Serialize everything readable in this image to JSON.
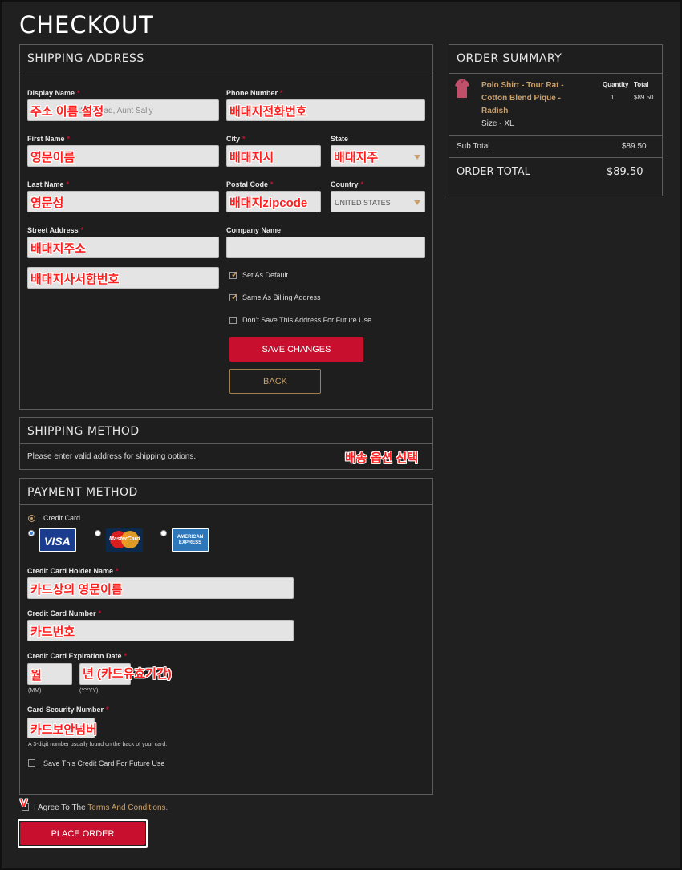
{
  "page": {
    "title": "CHECKOUT"
  },
  "shipping_address": {
    "heading": "SHIPPING ADDRESS",
    "display_name": {
      "label": "Display Name",
      "placeholder": "Grandma, Dad, Aunt Sally",
      "annotation": "주소 이름 설정"
    },
    "phone_number": {
      "label": "Phone Number",
      "annotation": "배대지전화번호"
    },
    "first_name": {
      "label": "First Name",
      "annotation": "영문이름"
    },
    "city": {
      "label": "City",
      "annotation": "배대지시"
    },
    "state": {
      "label": "State",
      "annotation": "배대지주"
    },
    "last_name": {
      "label": "Last Name",
      "annotation": "영문성"
    },
    "postal_code": {
      "label": "Postal Code",
      "annotation": "배대지zipcode"
    },
    "country": {
      "label": "Country",
      "value": "UNITED STATES"
    },
    "street_address": {
      "label": "Street Address",
      "annotation": "배대지주소",
      "annotation2": "배대지사서함번호"
    },
    "company_name": {
      "label": "Company Name"
    },
    "options": [
      {
        "label": "Set As Default",
        "checked": true
      },
      {
        "label": "Same As Billing Address",
        "checked": true
      },
      {
        "label": "Don't Save This Address For Future Use",
        "checked": false
      }
    ],
    "save_button": "SAVE CHANGES",
    "back_button": "BACK",
    "required_mark": "*"
  },
  "shipping_method": {
    "heading": "SHIPPING METHOD",
    "message": "Please enter valid address for shipping options.",
    "annotation": "배송 옵션 선택"
  },
  "payment_method": {
    "heading": "PAYMENT METHOD",
    "credit_card_label": "Credit Card",
    "cards": [
      {
        "name": "visa-card-icon",
        "text": "VISA",
        "selected": true
      },
      {
        "name": "mastercard-card-icon",
        "text": "MasterCard",
        "selected": false
      },
      {
        "name": "amex-card-icon",
        "text": "AMERICAN EXPRESS",
        "selected": false
      }
    ],
    "holder_name": {
      "label": "Credit Card Holder Name",
      "annotation": "카드상의 영문이름"
    },
    "card_number": {
      "label": "Credit Card Number",
      "annotation": "카드번호"
    },
    "expiration": {
      "label": "Credit Card Expiration Date",
      "month_annotation": "월",
      "year_annotation": "년 (카드유효기간)",
      "month_hint": "(MM)",
      "year_hint": "(YYYY)"
    },
    "security": {
      "label": "Card Security Number",
      "annotation": "카드보안넘버",
      "hint": "A 3-digit number usually found on the back of your card."
    },
    "save_card": "Save This Credit Card For Future Use"
  },
  "agree": {
    "prefix": "I Agree To The ",
    "link": "Terms And Conditions.",
    "annotation": "V"
  },
  "place_order": "PLACE ORDER",
  "order_summary": {
    "heading": "ORDER SUMMARY",
    "product": {
      "name": "Polo Shirt - Tour Rat - Cotton Blend Pique - Radish",
      "name_lines": [
        "Polo Shirt - Tour Rat -",
        "Cotton Blend Pique -",
        "Radish"
      ],
      "size": "Size - XL",
      "quantity_label": "Quantity",
      "total_label": "Total",
      "quantity": "1",
      "total": "$89.50"
    },
    "sub_total_label": "Sub Total",
    "sub_total": "$89.50",
    "order_total_label": "ORDER TOTAL",
    "order_total": "$89.50"
  },
  "colors": {
    "accent": "#c8102e",
    "gold": "#c9a06a",
    "background": "#202020"
  }
}
